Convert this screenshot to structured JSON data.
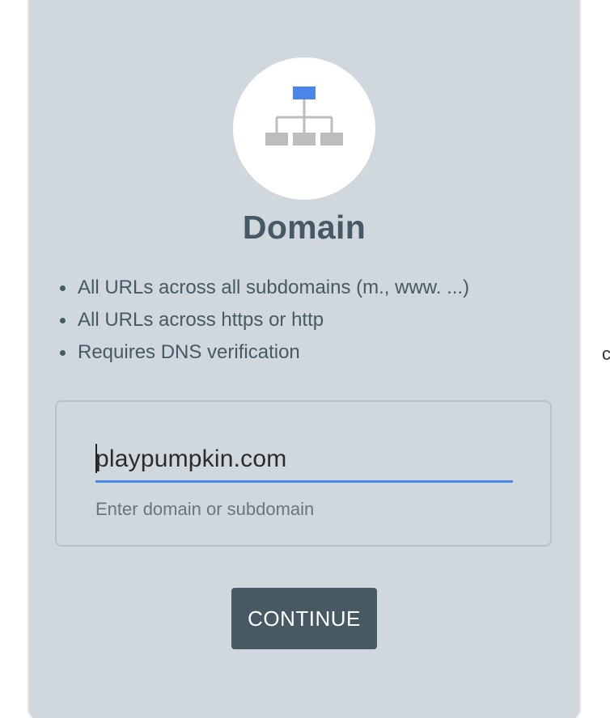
{
  "card": {
    "title": "Domain",
    "icon": "sitemap-icon",
    "bullets": [
      "All URLs across all subdomains (m., www. ...)",
      "All URLs across https or http",
      "Requires DNS verification"
    ],
    "input": {
      "value": "playpumpkin.com",
      "helper": "Enter domain or subdomain"
    },
    "continue_label": "CONTINUE"
  },
  "edge": {
    "glyph": "c"
  },
  "colors": {
    "card_bg": "#d0d8de",
    "title": "#455a64",
    "accent": "#4a8ae6",
    "button_bg": "#475a64"
  }
}
